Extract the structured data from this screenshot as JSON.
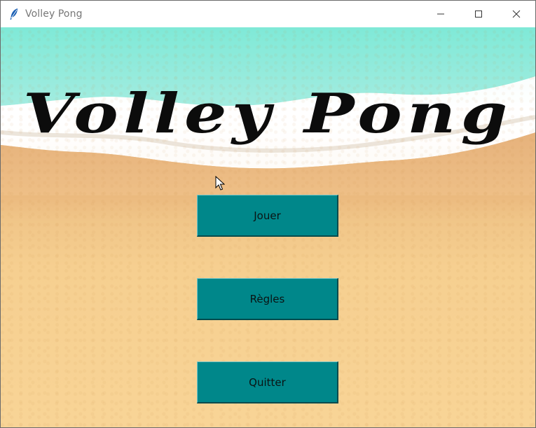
{
  "window": {
    "title": "Volley Pong",
    "icon": "feather-icon",
    "controls": {
      "minimize_icon": "minimize-icon",
      "maximize_icon": "maximize-icon",
      "close_icon": "close-icon"
    }
  },
  "game": {
    "title": "Volley Pong"
  },
  "menu": {
    "play_label": "Jouer",
    "rules_label": "Règles",
    "quit_label": "Quitter"
  },
  "colors": {
    "button_bg": "#00878a",
    "sea": "#7fe7d6",
    "sand": "#f8d496",
    "title_text": "#0c0c0c"
  }
}
